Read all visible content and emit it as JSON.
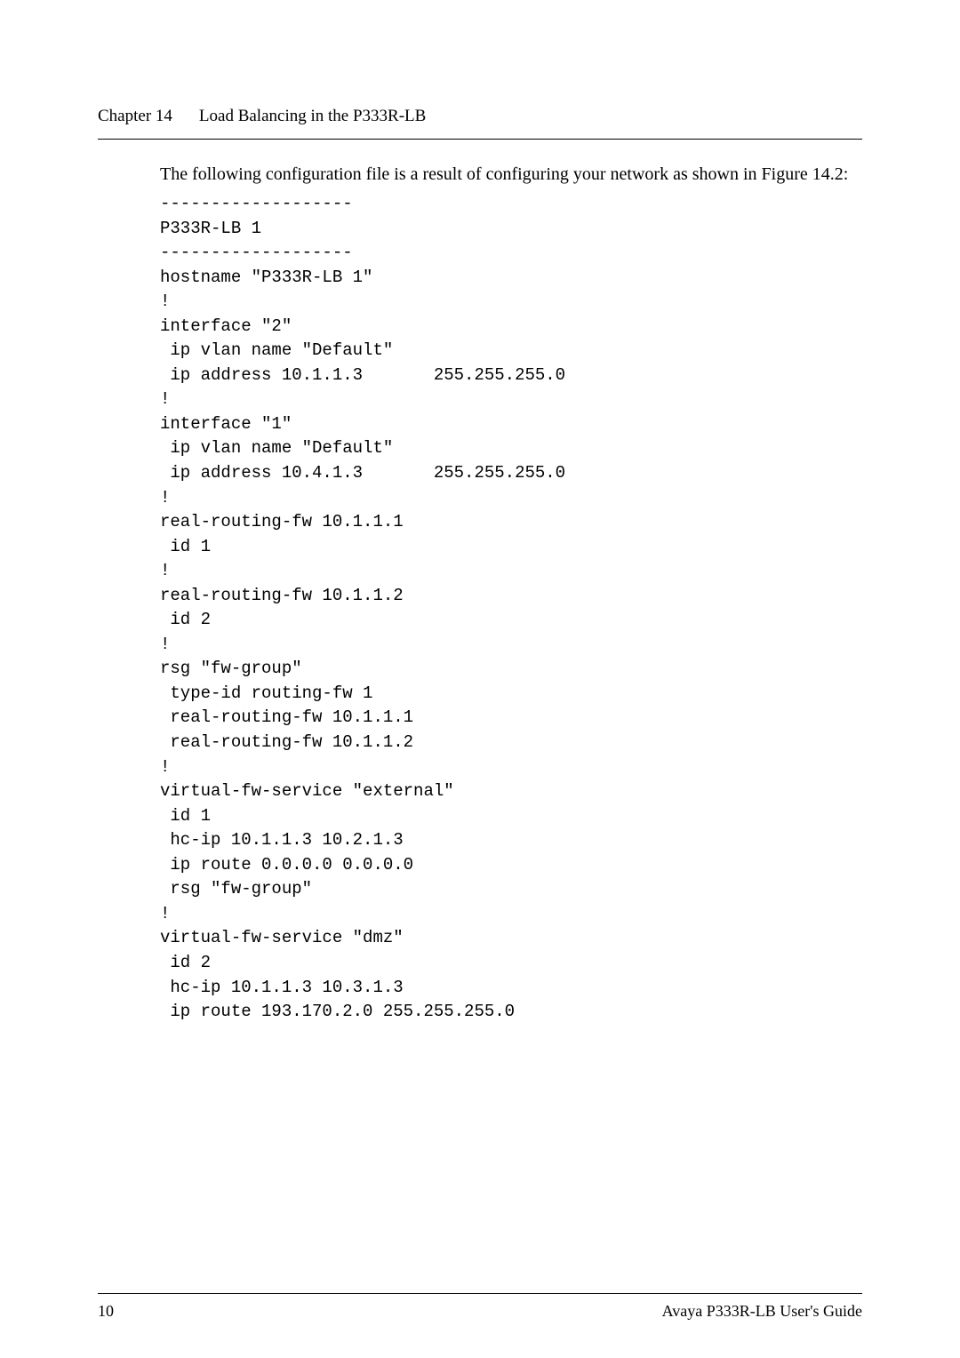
{
  "header": {
    "chapter_label": "Chapter 14",
    "chapter_title": "Load Balancing in the P333R-LB"
  },
  "intro": "The following configuration file is a result of configuring your network as shown in Figure 14.2:",
  "code": "-------------------\nP333R-LB 1\n-------------------\nhostname \"P333R-LB 1\"\n!\ninterface \"2\"\n ip vlan name \"Default\"\n ip address 10.1.1.3       255.255.255.0\n!\ninterface \"1\"\n ip vlan name \"Default\"\n ip address 10.4.1.3       255.255.255.0\n!\nreal-routing-fw 10.1.1.1\n id 1\n!\nreal-routing-fw 10.1.1.2\n id 2\n!\nrsg \"fw-group\"\n type-id routing-fw 1\n real-routing-fw 10.1.1.1\n real-routing-fw 10.1.1.2\n!\nvirtual-fw-service \"external\"\n id 1\n hc-ip 10.1.1.3 10.2.1.3\n ip route 0.0.0.0 0.0.0.0\n rsg \"fw-group\"\n!\nvirtual-fw-service \"dmz\"\n id 2\n hc-ip 10.1.1.3 10.3.1.3\n ip route 193.170.2.0 255.255.255.0",
  "footer": {
    "page_number": "10",
    "guide_title": "Avaya P333R-LB User's Guide"
  }
}
